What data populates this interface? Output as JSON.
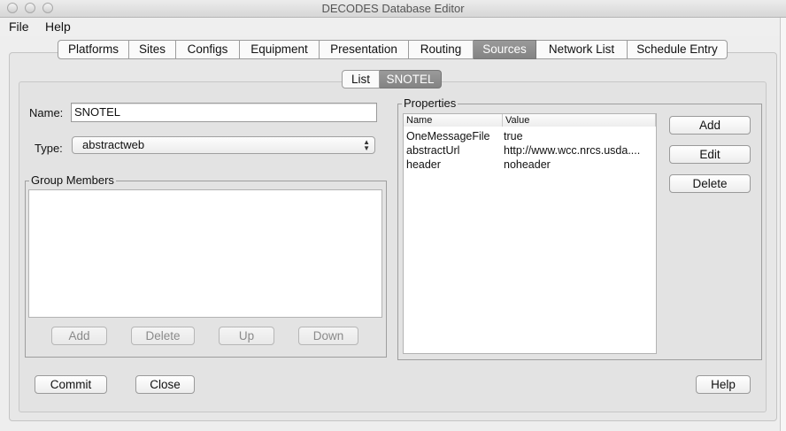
{
  "window": {
    "title": "DECODES Database Editor"
  },
  "menu": [
    "File",
    "Help"
  ],
  "tabs": [
    {
      "label": "Platforms"
    },
    {
      "label": "Sites"
    },
    {
      "label": "Configs"
    },
    {
      "label": "Equipment"
    },
    {
      "label": "Presentation"
    },
    {
      "label": "Routing"
    },
    {
      "label": "Sources",
      "active": true
    },
    {
      "label": "Network List"
    },
    {
      "label": "Schedule Entry"
    }
  ],
  "subtabs": [
    {
      "label": "List"
    },
    {
      "label": "SNOTEL",
      "active": true
    }
  ],
  "form": {
    "name_label": "Name:",
    "name_value": "SNOTEL",
    "type_label": "Type:",
    "type_value": "abstractweb"
  },
  "group_members": {
    "title": "Group Members",
    "buttons": [
      "Add",
      "Delete",
      "Up",
      "Down"
    ]
  },
  "properties": {
    "title": "Properties",
    "columns": [
      "Name",
      "Value"
    ],
    "rows": [
      {
        "name": "OneMessageFile",
        "value": "true"
      },
      {
        "name": "abstractUrl",
        "value": "http://www.wcc.nrcs.usda...."
      },
      {
        "name": "header",
        "value": "noheader"
      }
    ],
    "buttons": [
      "Add",
      "Edit",
      "Delete"
    ]
  },
  "footer": {
    "commit": "Commit",
    "close": "Close",
    "help": "Help"
  }
}
